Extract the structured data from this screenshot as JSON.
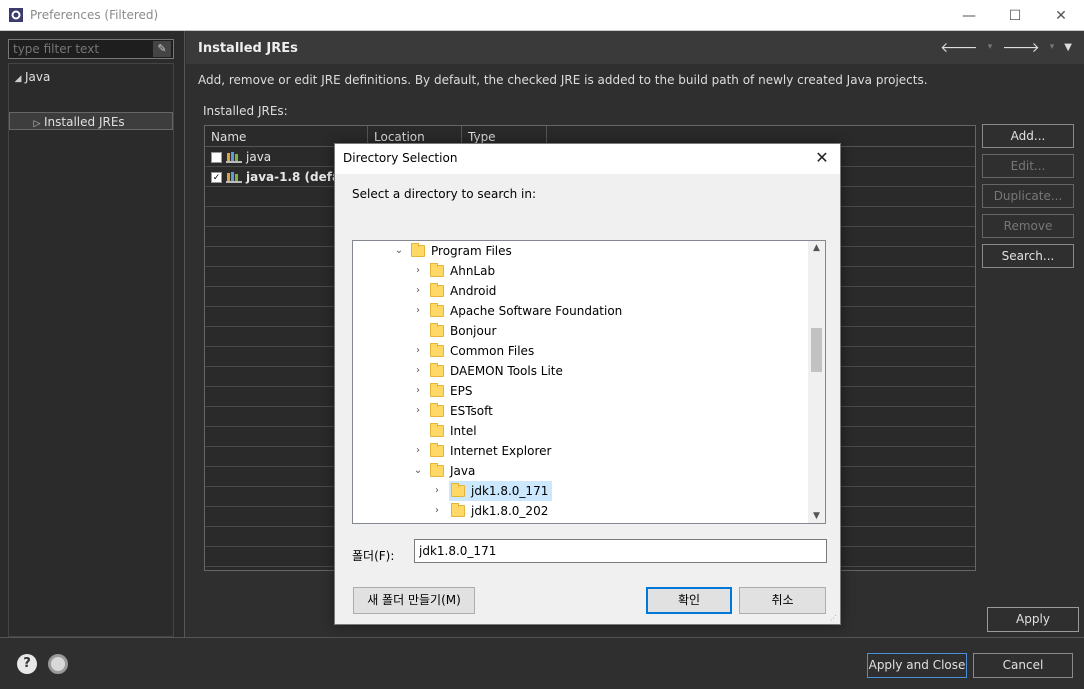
{
  "window": {
    "title": "Preferences (Filtered)",
    "minimize": "—",
    "maximize": "☐",
    "close": "✕"
  },
  "left": {
    "filter_placeholder": "type filter text",
    "clear_icon": "pencil-eraser",
    "tree": [
      {
        "label": "Java",
        "twisty": "◢"
      },
      {
        "label": "Installed JREs",
        "twisty": "▷"
      }
    ]
  },
  "page": {
    "title": "Installed JREs",
    "description": "Add, remove or edit JRE definitions. By default, the checked JRE is added to the build path of newly created Java projects.",
    "table_label": "Installed JREs:",
    "columns": [
      "Name",
      "Location",
      "Type"
    ],
    "rows": [
      {
        "name": "java",
        "checked": false,
        "check_mark": ""
      },
      {
        "name": "java-1.8 (default)",
        "checked": true,
        "check_mark": "✓"
      }
    ],
    "buttons": {
      "add": "Add...",
      "edit": "Edit...",
      "duplicate": "Duplicate...",
      "remove": "Remove",
      "search": "Search..."
    },
    "apply": "Apply"
  },
  "bottom": {
    "apply_close": "Apply and Close",
    "cancel": "Cancel",
    "help": "?"
  },
  "dialog": {
    "title": "Directory Selection",
    "close": "✕",
    "prompt": "Select a directory to search in:",
    "tree": [
      {
        "label": "Program Files",
        "expanded": true,
        "level": 0,
        "chev": "⌄"
      },
      {
        "label": "AhnLab",
        "level": 1,
        "chev": "›"
      },
      {
        "label": "Android",
        "level": 1,
        "chev": "›"
      },
      {
        "label": "Apache Software Foundation",
        "level": 1,
        "chev": "›"
      },
      {
        "label": "Bonjour",
        "level": 1,
        "chev": ""
      },
      {
        "label": "Common Files",
        "level": 1,
        "chev": "›"
      },
      {
        "label": "DAEMON Tools Lite",
        "level": 1,
        "chev": "›"
      },
      {
        "label": "EPS",
        "level": 1,
        "chev": "›"
      },
      {
        "label": "ESTsoft",
        "level": 1,
        "chev": "›"
      },
      {
        "label": "Intel",
        "level": 1,
        "chev": ""
      },
      {
        "label": "Internet Explorer",
        "level": 1,
        "chev": "›"
      },
      {
        "label": "Java",
        "expanded": true,
        "level": 1,
        "chev": "⌄"
      },
      {
        "label": "jdk1.8.0_171",
        "level": 2,
        "selected": true,
        "chev": "›"
      },
      {
        "label": "jdk1.8.0_202",
        "level": 2,
        "chev": "›"
      }
    ],
    "folder_label": "폴더(F):",
    "folder_value": "jdk1.8.0_171",
    "new_folder": "새 폴더 만들기(M)",
    "ok": "확인",
    "cancel": "취소"
  }
}
